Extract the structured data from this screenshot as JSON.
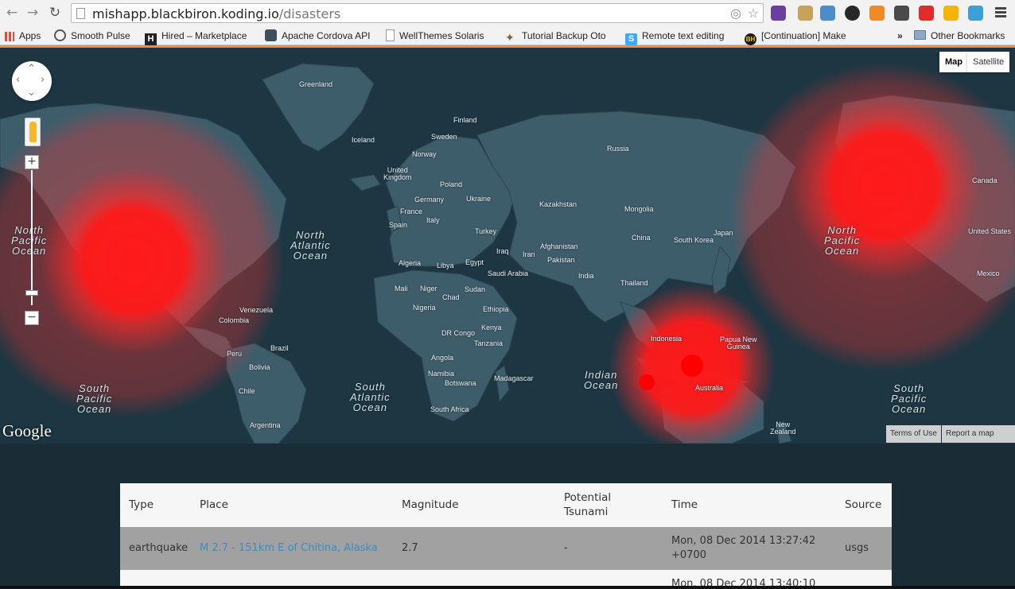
{
  "browser": {
    "url_host": "mishapp.blackbiron.koding.io",
    "url_path": "/disasters",
    "bookmarks": [
      {
        "label": "Apps",
        "icon": "apps-grid-icon",
        "color": "#e34c3b"
      },
      {
        "label": "Smooth Pulse",
        "icon": "smooth-pulse-icon",
        "color": "#555555"
      },
      {
        "label": "Hired – Marketplace",
        "icon": "hired-icon",
        "color": "#222222"
      },
      {
        "label": "Apache Cordova API",
        "icon": "cordova-icon",
        "color": "#3f4e5c"
      },
      {
        "label": "WellThemes Solaris",
        "icon": "page-icon",
        "color": "#ffffff"
      },
      {
        "label": "Tutorial Backup Oto",
        "icon": "tutorial-icon",
        "color": "#8a5a2b"
      },
      {
        "label": "Remote text editing",
        "icon": "simplenote-icon",
        "color": "#3fa9f5"
      },
      {
        "label": "[Continuation] Make",
        "icon": "bh-icon",
        "color": "#1b1b1b"
      }
    ],
    "overflow_label": "»",
    "other_bookmarks": "Other Bookmarks",
    "extension_colors": [
      "#6b3fa0",
      "#c7a25a",
      "#4c8cc9",
      "#27272a",
      "#f08a24",
      "#4a4a4a",
      "#e32b2b",
      "#f5b400",
      "#3aa0d8"
    ]
  },
  "map": {
    "maptype_buttons": [
      "Map",
      "Satellite"
    ],
    "zoom_in": "+",
    "zoom_out": "−",
    "logo": "Google",
    "footer_links": [
      "Terms of Use",
      "Report a map error"
    ],
    "place_labels": [
      "Greenland",
      "Finland",
      "Iceland",
      "Sweden",
      "Norway",
      "Russia",
      "United Kingdom",
      "Poland",
      "Germany",
      "Ukraine",
      "France",
      "Kazakhstan",
      "Mongolia",
      "Italy",
      "Spain",
      "Turkey",
      "China",
      "South Korea",
      "Japan",
      "Afghanistan",
      "Iraq",
      "Iran",
      "Algeria",
      "Libya",
      "Egypt",
      "Pakistan",
      "Saudi Arabia",
      "India",
      "Thailand",
      "Mali",
      "Niger",
      "Chad",
      "Sudan",
      "Nigeria",
      "Ethiopia",
      "DR Congo",
      "Kenya",
      "Tanzania",
      "Angola",
      "Namibia",
      "Botswana",
      "Madagascar",
      "South Africa",
      "Indonesia",
      "Papua New Guinea",
      "Australia",
      "New Zealand",
      "Canada",
      "United States",
      "Mexico",
      "Venezuela",
      "Colombia",
      "Peru",
      "Brazil",
      "Bolivia",
      "Chile",
      "Argentina"
    ],
    "oceans": [
      "North Pacific Ocean",
      "North Atlantic Ocean",
      "South Pacific Ocean",
      "South Atlantic Ocean",
      "Indian Ocean"
    ],
    "heat_color": "#ff1a1a"
  },
  "table": {
    "headers": [
      "Type",
      "Place",
      "Magnitude",
      "Potential Tsunami",
      "Time",
      "Source"
    ],
    "rows": [
      {
        "type": "earthquake",
        "place": "M 2.7 - 151km E of Chitina, Alaska",
        "magnitude": "2.7",
        "tsunami": "-",
        "time": "Mon, 08 Dec 2014 13:27:42 +0700",
        "source": "usgs"
      },
      {
        "time": "Mon, 08 Dec 2014 13:40:10"
      }
    ]
  }
}
